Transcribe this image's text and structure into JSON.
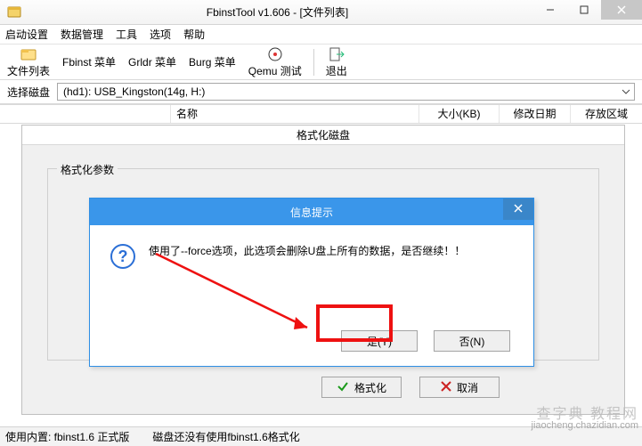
{
  "window": {
    "title": "FbinstTool v1.606 - [文件列表]"
  },
  "menu": {
    "items": [
      "启动设置",
      "数据管理",
      "工具",
      "选项",
      "帮助"
    ]
  },
  "toolbar": {
    "file_list": "文件列表",
    "fbinst_menu": "Fbinst 菜单",
    "grldr_menu": "Grldr 菜单",
    "burg_menu": "Burg 菜单",
    "qemu_test": "Qemu 测试",
    "exit": "退出"
  },
  "disk": {
    "label": "选择磁盘",
    "value": "(hd1): USB_Kingston(14g, H:)"
  },
  "columns": {
    "c1": "名称",
    "c2": "大小(KB)",
    "c3": "修改日期",
    "c4": "存放区域"
  },
  "formatdlg": {
    "title": "格式化磁盘",
    "group": "格式化参数",
    "format_btn": "格式化",
    "cancel_btn": "取消"
  },
  "msgdlg": {
    "title": "信息提示",
    "body": "使用了--force选项，此选项会删除U盘上所有的数据，是否继续！！",
    "yes": "是(Y)",
    "no": "否(N)"
  },
  "status": {
    "seg1": "使用内置: fbinst1.6 正式版",
    "seg2": "磁盘还没有使用fbinst1.6格式化"
  },
  "watermark": {
    "line1": "查字典 教程网",
    "line2": "jiaocheng.chazidian.com"
  }
}
